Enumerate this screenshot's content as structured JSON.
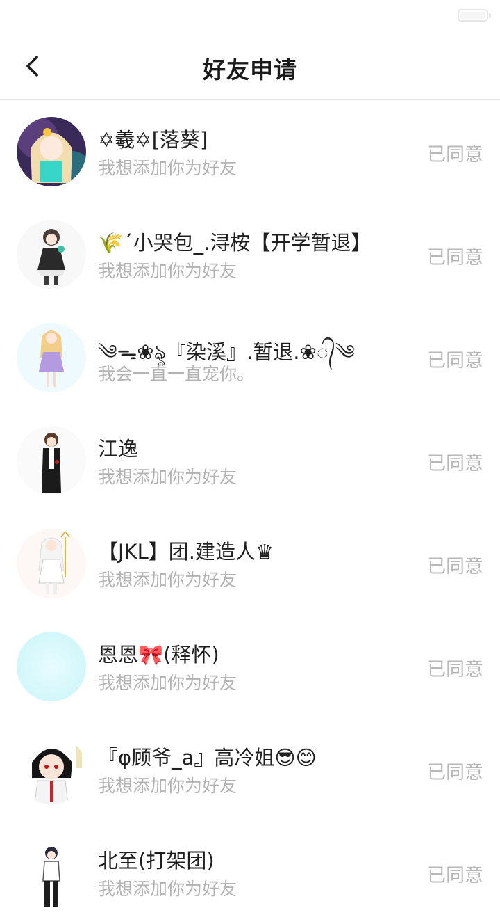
{
  "header": {
    "title": "好友申请"
  },
  "requests": [
    {
      "name": "✡羲✡[落葵]",
      "message": "我想添加你为好友",
      "status": "已同意"
    },
    {
      "name": "🌾´小哭包_.浔桉【开学暂退】",
      "message": "我想添加你为好友",
      "status": "已同意"
    },
    {
      "name": "༄ᯓ❀ৡ『染溪』.暂退.❀᭄༄",
      "message": "我会一直一直宠你。",
      "status": "已同意"
    },
    {
      "name": "江逸",
      "message": "我想添加你为好友",
      "status": "已同意"
    },
    {
      "name": "【JKL】团.建造人♛",
      "message": "我想添加你为好友",
      "status": "已同意"
    },
    {
      "name": "恩恩🎀(释怀)",
      "message": "我想添加你为好友",
      "status": "已同意"
    },
    {
      "name": "『φ顾爷_a』高冷姐😎😊",
      "message": "我想添加你为好友",
      "status": "已同意"
    },
    {
      "name": "北至(打架团)",
      "message": "我想添加你为好友",
      "status": "已同意"
    }
  ]
}
